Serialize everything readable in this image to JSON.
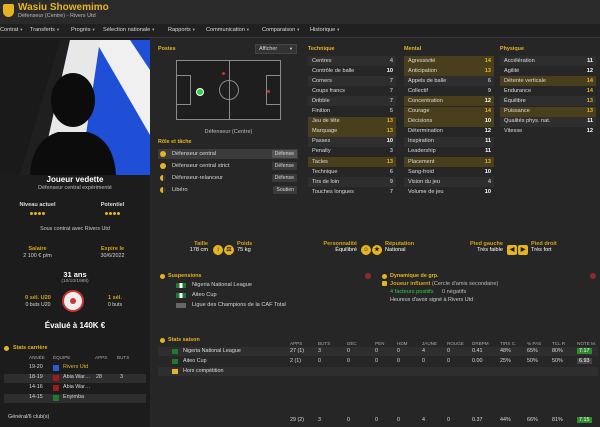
{
  "header": {
    "name": "Wasiu Showemimo",
    "subtitle": "Défenseur (Centre) - Rivers Utd"
  },
  "menu": [
    "Contrat",
    "Transferts",
    "Progrès",
    "Sélection nationale",
    "Rapports",
    "Communication",
    "Comparaison",
    "Historique"
  ],
  "profile": {
    "status_title": "Joueur vedette",
    "status_sub": "Défenseur central expérimenté",
    "level_label": "Niveau actuel",
    "potential_label": "Potentiel",
    "contract_text": "Sous contrat avec Rivers Utd",
    "salary_label": "Salaire",
    "salary_value": "2 100 € p/m",
    "expiry_label": "Expire le",
    "expiry_value": "30/6/2022",
    "age": "31 ans",
    "dob": "(10/10/1988)",
    "u20_label": "0 sél. U20",
    "u20_goals": "0 buts U20",
    "caps_label": "1 sél.",
    "caps_goals": "0 buts",
    "value": "Évalué à 140K €"
  },
  "career": {
    "title": "Stats carrière",
    "headers": [
      "ANNÉE",
      "ÉQUIPE",
      "APPS",
      "BUTS"
    ],
    "rows": [
      {
        "year": "19-20",
        "team": "Rivers Utd",
        "apps": "",
        "goals": ""
      },
      {
        "year": "18-19",
        "team": "Abia War…",
        "apps": "28",
        "goals": "3"
      },
      {
        "year": "14-16",
        "team": "Abia War…",
        "apps": "",
        "goals": ""
      },
      {
        "year": "14-15",
        "team": "Enyimba",
        "apps": "",
        "goals": ""
      },
      {
        "year": "",
        "team": "",
        "apps": "",
        "goals": ""
      }
    ],
    "total_label": "Général/6 club(s)"
  },
  "positions": {
    "title": "Postes",
    "dropdown": "Afficher",
    "caption": "Défenseur (Centre)"
  },
  "roles": {
    "title": "Rôle et tâche",
    "rows": [
      {
        "name": "Défenseur central",
        "duty": "Défense"
      },
      {
        "name": "Défenseur central strict",
        "duty": "Défense"
      },
      {
        "name": "Défenseur-relanceur",
        "duty": "Défense"
      },
      {
        "name": "Libéro",
        "duty": "Soutien"
      }
    ]
  },
  "technique": {
    "title": "Technique",
    "rows": [
      {
        "name": "Centres",
        "v": "4"
      },
      {
        "name": "Contrôle de balle",
        "v": "10"
      },
      {
        "name": "Corners",
        "v": "7"
      },
      {
        "name": "Coups francs",
        "v": "7"
      },
      {
        "name": "Dribble",
        "v": "7"
      },
      {
        "name": "Finition",
        "v": "5"
      },
      {
        "name": "Jeu de tête",
        "v": "13"
      },
      {
        "name": "Marquage",
        "v": "13"
      },
      {
        "name": "Passes",
        "v": "10"
      },
      {
        "name": "Penalty",
        "v": "3"
      },
      {
        "name": "Tacles",
        "v": "13"
      },
      {
        "name": "Technique",
        "v": "6"
      },
      {
        "name": "Tirs de loin",
        "v": "9"
      },
      {
        "name": "Touches longues",
        "v": "7"
      }
    ]
  },
  "mental": {
    "title": "Mental",
    "rows": [
      {
        "name": "Agressivité",
        "v": "14"
      },
      {
        "name": "Anticipation",
        "v": "13"
      },
      {
        "name": "Appels de balle",
        "v": "6"
      },
      {
        "name": "Collectif",
        "v": "9"
      },
      {
        "name": "Concentration",
        "v": "12"
      },
      {
        "name": "Courage",
        "v": "14"
      },
      {
        "name": "Décisions",
        "v": "10"
      },
      {
        "name": "Détermination",
        "v": "12"
      },
      {
        "name": "Inspiration",
        "v": "11"
      },
      {
        "name": "Leadership",
        "v": "11"
      },
      {
        "name": "Placement",
        "v": "13"
      },
      {
        "name": "Sang-froid",
        "v": "10"
      },
      {
        "name": "Vision du jeu",
        "v": "4"
      },
      {
        "name": "Volume de jeu",
        "v": "10"
      }
    ]
  },
  "physique": {
    "title": "Physique",
    "rows": [
      {
        "name": "Accélération",
        "v": "11"
      },
      {
        "name": "Agilité",
        "v": "12"
      },
      {
        "name": "Détente verticale",
        "v": "14"
      },
      {
        "name": "Endurance",
        "v": "14"
      },
      {
        "name": "Équilibre",
        "v": "13"
      },
      {
        "name": "Puissance",
        "v": "13"
      },
      {
        "name": "Qualités phys. nat.",
        "v": "11"
      },
      {
        "name": "Vitesse",
        "v": "12"
      }
    ]
  },
  "attributes": {
    "height_label": "Taille",
    "height_value": "178 cm",
    "weight_label": "Poids",
    "weight_value": "75 kg",
    "personality_label": "Personnalité",
    "personality_value": "Équilibré",
    "reputation_label": "Réputation",
    "reputation_value": "National",
    "left_foot_label": "Pied gauche",
    "left_foot_value": "Très faible",
    "right_foot_label": "Pied droit",
    "right_foot_value": "Très fort"
  },
  "suspensions": {
    "title": "Suspensions",
    "rows": [
      "Nigeria National League",
      "Aiteo Cup",
      "Ligue des Champions de la CAF Total"
    ]
  },
  "dynamics": {
    "title": "Dynamique de grp.",
    "role": "Joueur influent",
    "role_sub": "(Cercle d'amis secondaire)",
    "factors": "4 facteurs positifs",
    "neg": "0 négatifs",
    "signed": "Heureux d'avoir signé à Rivers Utd"
  },
  "season": {
    "title": "Stats saison",
    "headers": [
      "APPS",
      "BUTS",
      "DÉC",
      "PEN",
      "HDM",
      "JAUNE",
      "ROUGE",
      "DRBPM",
      "TIRS C.",
      "% PAS",
      "TCL R",
      "NOTE M."
    ],
    "rows": [
      {
        "name": "Nigeria National League",
        "vals": [
          "27 (1)",
          "3",
          "0",
          "0",
          "0",
          "4",
          "0",
          "0.41",
          "48%",
          "65%",
          "80%",
          "7.17"
        ]
      },
      {
        "name": "Aiteo Cup",
        "vals": [
          "2 (1)",
          "0",
          "0",
          "0",
          "0",
          "0",
          "0",
          "0.00",
          "25%",
          "50%",
          "50%",
          "6.93"
        ]
      },
      {
        "name": "Hors compétition",
        "vals": [
          "",
          "",
          "",
          "",
          "",
          "",
          "",
          "",
          "",
          "",
          "",
          ""
        ]
      }
    ],
    "total": [
      "29 (2)",
      "3",
      "0",
      "0",
      "0",
      "4",
      "0",
      "0.37",
      "44%",
      "66%",
      "81%",
      "7.15"
    ]
  }
}
